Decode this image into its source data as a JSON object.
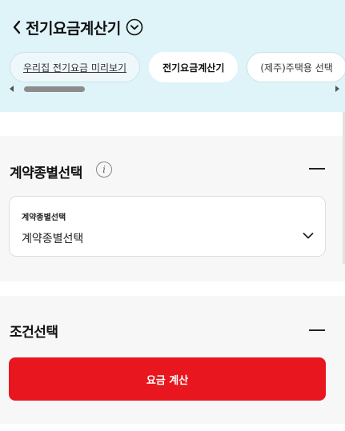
{
  "header": {
    "title": "전기요금계산기",
    "tabs": [
      {
        "label": "우리집 전기요금 미리보기"
      },
      {
        "label": "전기요금계산기"
      },
      {
        "label": "(제주)주택용 선택"
      }
    ],
    "active_tab": 1
  },
  "contract_section": {
    "title": "계약종별선택",
    "select": {
      "label": "계약종별선택",
      "value": "계약종별선택"
    }
  },
  "condition_section": {
    "title": "조건선택",
    "calculate_label": "요금 계산"
  },
  "colors": {
    "header_bg": "#dff4f8",
    "accent": "#e8161e",
    "section_bg": "#f7f7f7"
  },
  "icons": [
    "back-arrow-icon",
    "chevron-down-circle-icon",
    "info-icon",
    "collapse-icon",
    "chevron-down-icon"
  ]
}
